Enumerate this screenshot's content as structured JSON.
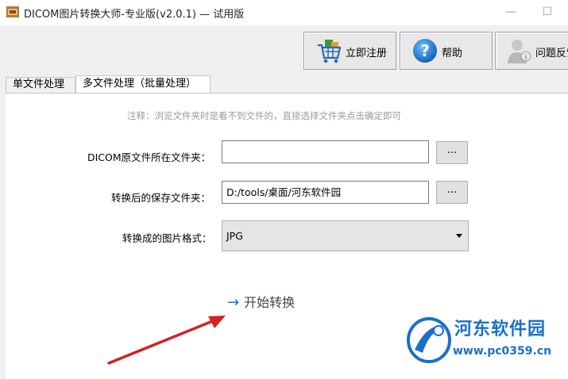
{
  "window": {
    "title": "DICOM图片转换大师-专业版(v2.0.1) — 试用版",
    "min_glyph": "—",
    "max_glyph": "☐"
  },
  "toolbar": {
    "register_label": "立即注册",
    "help_label": "帮助",
    "feedback_label": "问题反馈",
    "help_glyph": "?"
  },
  "tabs": {
    "single": "单文件处理",
    "batch": "多文件处理（批量处理）"
  },
  "batch": {
    "note": "注释：浏览文件夹时是看不到文件的，直接选择文件夹点击确定即可",
    "source_label": "DICOM原文件所在文件夹：",
    "source_value": "",
    "save_label": "转换后的保存文件夹：",
    "save_value": "D:/tools/桌面/河东软件园",
    "format_label": "转换成的图片格式：",
    "format_value": "JPG",
    "browse_label": "...",
    "start_label": "开始转换",
    "start_arrow": "→"
  },
  "watermark": {
    "name": "河东软件园",
    "url": "www.pc0359.cn"
  },
  "colors": {
    "accent": "#1a6fc9",
    "arrow": "#d42020"
  }
}
